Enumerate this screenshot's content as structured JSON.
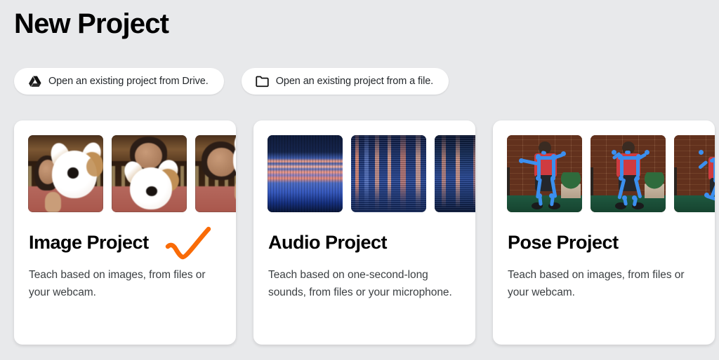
{
  "page": {
    "title": "New Project",
    "background_color": "#e8e9eb",
    "accent_color": "#f96b07"
  },
  "open_buttons": [
    {
      "id": "open-from-drive",
      "label": "Open an existing project from Drive.",
      "icon": "google-drive-icon"
    },
    {
      "id": "open-from-file",
      "label": "Open an existing project from a file.",
      "icon": "folder-icon"
    }
  ],
  "cards": [
    {
      "id": "image-project",
      "title": "Image Project",
      "description": "Teach based on images, from files or your webcam.",
      "selected": true,
      "check_icon": "orange-check-icon",
      "thumbnails": [
        "webcam-corgi-1",
        "webcam-corgi-2",
        "webcam-corgi-3"
      ]
    },
    {
      "id": "audio-project",
      "title": "Audio Project",
      "description": "Teach based on one-second-long sounds, from files or your microphone.",
      "selected": false,
      "thumbnails": [
        "spectrogram-1",
        "spectrogram-2",
        "spectrogram-3"
      ]
    },
    {
      "id": "pose-project",
      "title": "Pose Project",
      "description": "Teach based on images, from files or your webcam.",
      "selected": false,
      "thumbnails": [
        "pose-skeleton-1",
        "pose-skeleton-2",
        "pose-skeleton-3"
      ]
    }
  ]
}
